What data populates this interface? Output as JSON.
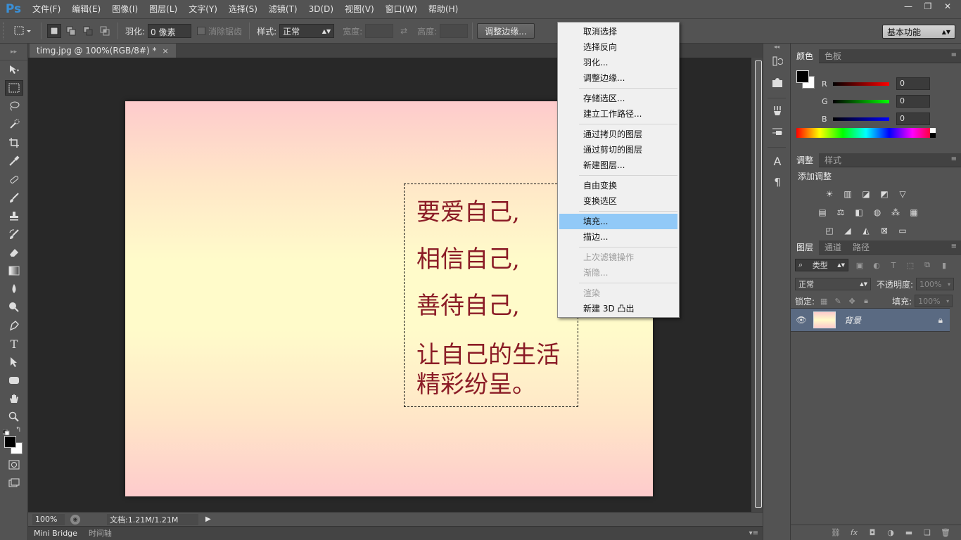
{
  "app": {
    "logo": "Ps",
    "menu": [
      "文件(F)",
      "编辑(E)",
      "图像(I)",
      "图层(L)",
      "文字(Y)",
      "选择(S)",
      "滤镜(T)",
      "3D(D)",
      "视图(V)",
      "窗口(W)",
      "帮助(H)"
    ],
    "window_controls": [
      "—",
      "❐",
      "✕"
    ]
  },
  "options_bar": {
    "feather_label": "羽化:",
    "feather_value": "0 像素",
    "antialias_label": "消除锯齿",
    "style_label": "样式:",
    "style_value": "正常",
    "width_label": "宽度:",
    "height_label": "高度:",
    "refine_edge_button": "调整边缘...",
    "workspace": "基本功能"
  },
  "document": {
    "tab_title": "timg.jpg @ 100%(RGB/8#) *",
    "tab_close": "×",
    "zoom": "100%",
    "doc_info": "文档:1.21M/1.21M",
    "image_lines": [
      "要爱自己,",
      "相信自己,",
      "善待自己,",
      "让自己的生活",
      "精彩纷呈。"
    ]
  },
  "bottom_tabs": [
    "Mini Bridge",
    "时间轴"
  ],
  "color_panel": {
    "tabs": [
      "颜色",
      "色板"
    ],
    "r_label": "R",
    "g_label": "G",
    "b_label": "B",
    "r_value": "0",
    "g_value": "0",
    "b_value": "0"
  },
  "adjust_panel": {
    "tabs": [
      "调整",
      "样式"
    ],
    "title": "添加调整"
  },
  "layers_panel": {
    "tabs": [
      "图层",
      "通道",
      "路径"
    ],
    "filter_type": "类型",
    "blend_mode": "正常",
    "opacity_label": "不透明度:",
    "opacity_value": "100%",
    "lock_label": "锁定:",
    "fill_label": "填充:",
    "fill_value": "100%",
    "layer_name": "背景"
  },
  "context_menu": {
    "group1": [
      "取消选择",
      "选择反向",
      "羽化...",
      "调整边缘..."
    ],
    "group2": [
      "存储选区...",
      "建立工作路径..."
    ],
    "group3": [
      "通过拷贝的图层",
      "通过剪切的图层",
      "新建图层..."
    ],
    "group4": [
      "自由变换",
      "变换选区"
    ],
    "group5": [
      "填充...",
      "描边..."
    ],
    "group6": [
      "上次滤镜操作",
      "渐隐..."
    ],
    "group7": [
      "渲染",
      "新建 3D 凸出"
    ],
    "highlighted": "填充..."
  },
  "colors": {
    "image_text": "#8b1c26",
    "menu_highlight": "#91c9f7",
    "ps_blue": "#3a8fd6"
  }
}
